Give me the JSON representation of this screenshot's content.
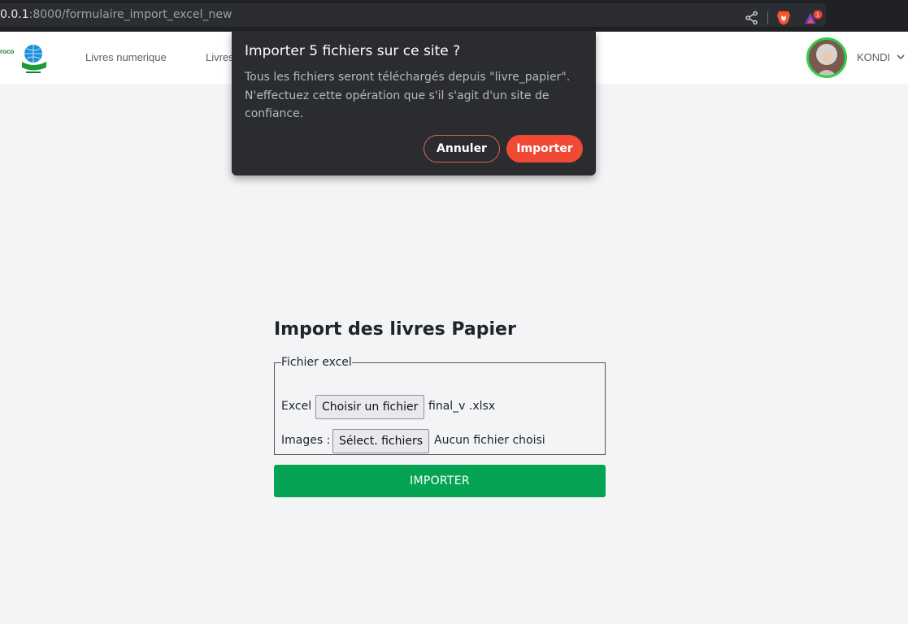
{
  "browser": {
    "url_host": "0.0.1",
    "url_path": ":8000/formulaire_import_excel_new",
    "icons": [
      "share-icon",
      "brave-lion-icon",
      "brave-rewards-icon"
    ],
    "rewards_badge": "1"
  },
  "navbar": {
    "logo_text": "roco",
    "links": [
      "Livres numerique",
      "Livres"
    ],
    "user_name": "KONDI"
  },
  "dialog": {
    "title": "Importer 5 fichiers sur ce site ?",
    "body": "Tous les fichiers seront téléchargés depuis \"livre_papier\". N'effectuez cette opération que s'il s'agit d'un site de confiance.",
    "cancel_label": "Annuler",
    "import_label": "Importer"
  },
  "form": {
    "title": "Import des livres Papier",
    "fieldset_legend": "Fichier excel",
    "excel_label": "Excel",
    "excel_button": "Choisir un fichier",
    "excel_filename": "final_v .xlsx",
    "images_label": "Images :",
    "images_button": "Sélect. fichiers",
    "images_filename": "Aucun fichier choisi",
    "submit_label": "IMPORTER"
  },
  "colors": {
    "dialog_bg": "#2a2c30",
    "accent_red": "#f04a36",
    "submit_green": "#04a454",
    "avatar_ring": "#2fd24a"
  }
}
